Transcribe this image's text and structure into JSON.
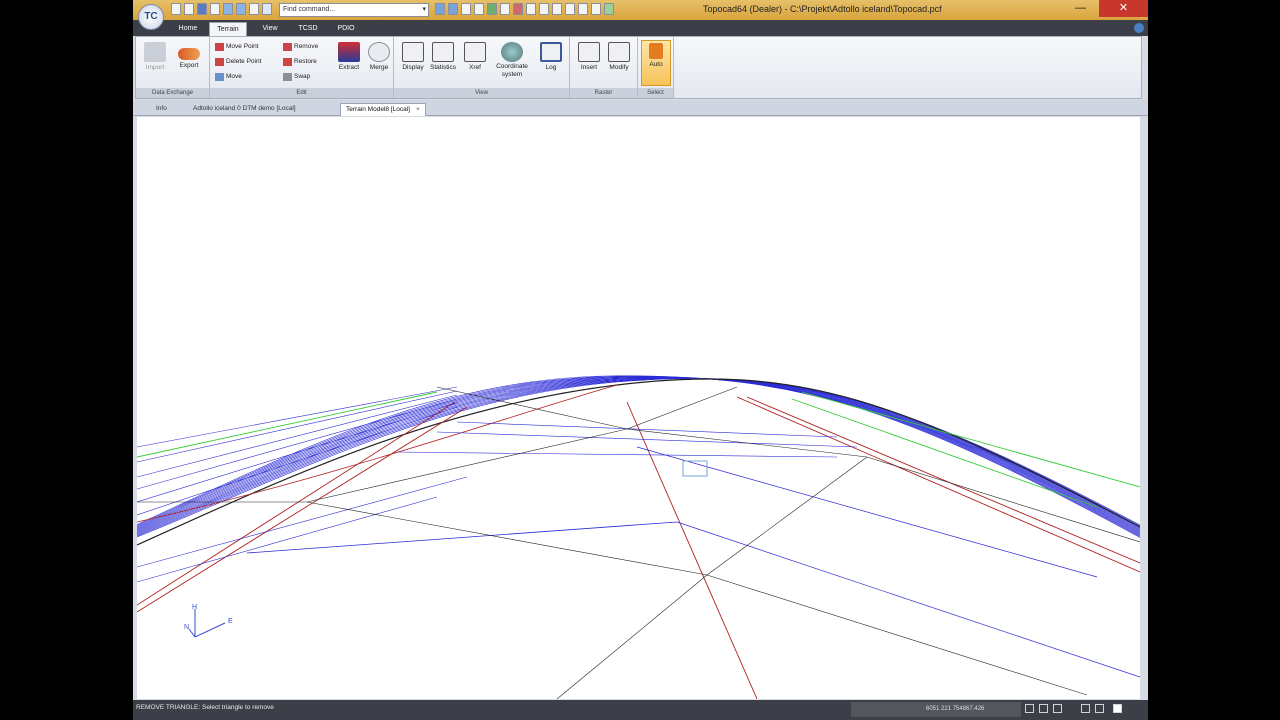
{
  "app": {
    "logo_text": "TC",
    "window_title": "Topocad64 (Dealer) - C:\\Projekt\\Adtollo iceland\\Topocad.pcf",
    "min_symbol": "—",
    "close_symbol": "✕"
  },
  "quick_access": {
    "find_placeholder": "Find command...",
    "find_dropdown": "▾"
  },
  "ribbon_tabs": [
    "Home",
    "Terrain",
    "View",
    "TCSD",
    "PDIO"
  ],
  "active_tab": "Terrain",
  "ribbon": {
    "groups": [
      "Data Exchange",
      "Edit",
      "View",
      "Raster",
      "Select"
    ],
    "data_exchange": {
      "import": "Import",
      "export": "Export"
    },
    "edit": {
      "move_point": "Move Point",
      "delete_point": "Delete Point",
      "move": "Move",
      "remove": "Remove",
      "restore": "Restore",
      "swap": "Swap",
      "extract": "Extract",
      "merge": "Merge"
    },
    "view": {
      "display": "Display",
      "statistics": "Statistics",
      "xref": "Xref",
      "coordinate_system_1": "Coordinate",
      "coordinate_system_2": "system",
      "log": "Log"
    },
    "raster": {
      "insert": "Insert",
      "modify": "Modify"
    },
    "select": {
      "auto": "Auto"
    }
  },
  "doc_tabs": [
    {
      "label": "Info"
    },
    {
      "label": "Adtollo iceland 0 DTM demo [Local]"
    },
    {
      "label": "Terrain Model8 [Local]",
      "close": "×"
    }
  ],
  "compass": {
    "h": "H",
    "n": "N",
    "e": "E"
  },
  "status": {
    "message": "REMOVE TRIANGLE: Select triangle to remove",
    "coordinates": "6051 221 754867.426"
  },
  "colors": {
    "title_bar": "#d9a43c",
    "tab_bar": "#3d3f48",
    "mesh_blue": "#2b2bd6",
    "mesh_red": "#b02020",
    "mesh_green": "#33cc33",
    "mesh_black": "#222222"
  }
}
